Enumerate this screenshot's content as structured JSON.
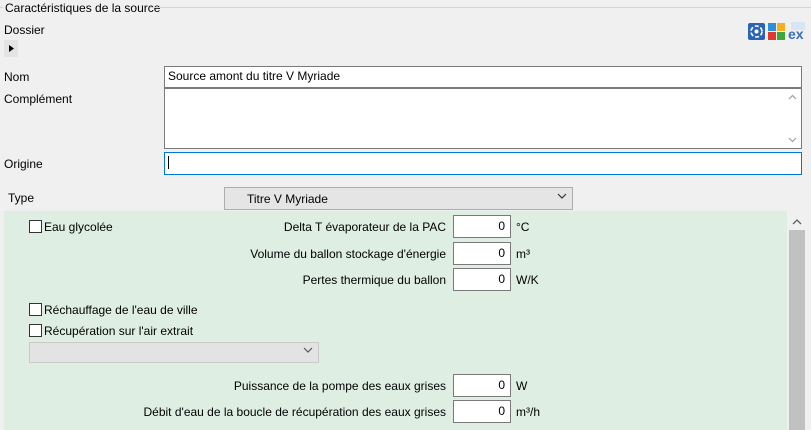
{
  "section": {
    "title": "Caractéristiques de la source"
  },
  "dossier": {
    "label": "Dossier"
  },
  "fields": {
    "nom_label": "Nom",
    "nom_value": "Source amont du titre V Myriade",
    "complement_label": "Complément",
    "complement_value": "",
    "origine_label": "Origine",
    "origine_value": ""
  },
  "toolbar_icons": {
    "icon1": "swirl-logo-icon",
    "icon2": "colored-grid-icon",
    "icon3": "ex-export-icon",
    "ex_text": "ex"
  },
  "type": {
    "label": "Type",
    "selected": "Titre V Myriade"
  },
  "form": {
    "eau_glycolee": {
      "label": "Eau glycolée",
      "checked": false
    },
    "delta_t": {
      "label": "Delta T évaporateur de la PAC",
      "value": "0",
      "unit": "°C"
    },
    "volume_ballon": {
      "label": "Volume du ballon stockage d'énergie",
      "value": "0",
      "unit": "m³"
    },
    "pertes_ballon": {
      "label": "Pertes thermique du ballon",
      "value": "0",
      "unit": "W/K"
    },
    "rechauffage": {
      "label": "Réchauffage de l'eau de ville",
      "checked": false
    },
    "recuperation_air": {
      "label": "Récupération sur l'air extrait",
      "checked": false
    },
    "dropdown": {
      "selected": ""
    },
    "puissance_pompe": {
      "label": "Puissance de la pompe des eaux grises",
      "value": "0",
      "unit": "W"
    },
    "debit_eau": {
      "label": "Débit d'eau de la boucle de récupération des eaux grises",
      "value": "0",
      "unit": "m³/h"
    }
  },
  "colors": {
    "panel_bg": "#dfeee2",
    "focus_border": "#0078d7"
  }
}
